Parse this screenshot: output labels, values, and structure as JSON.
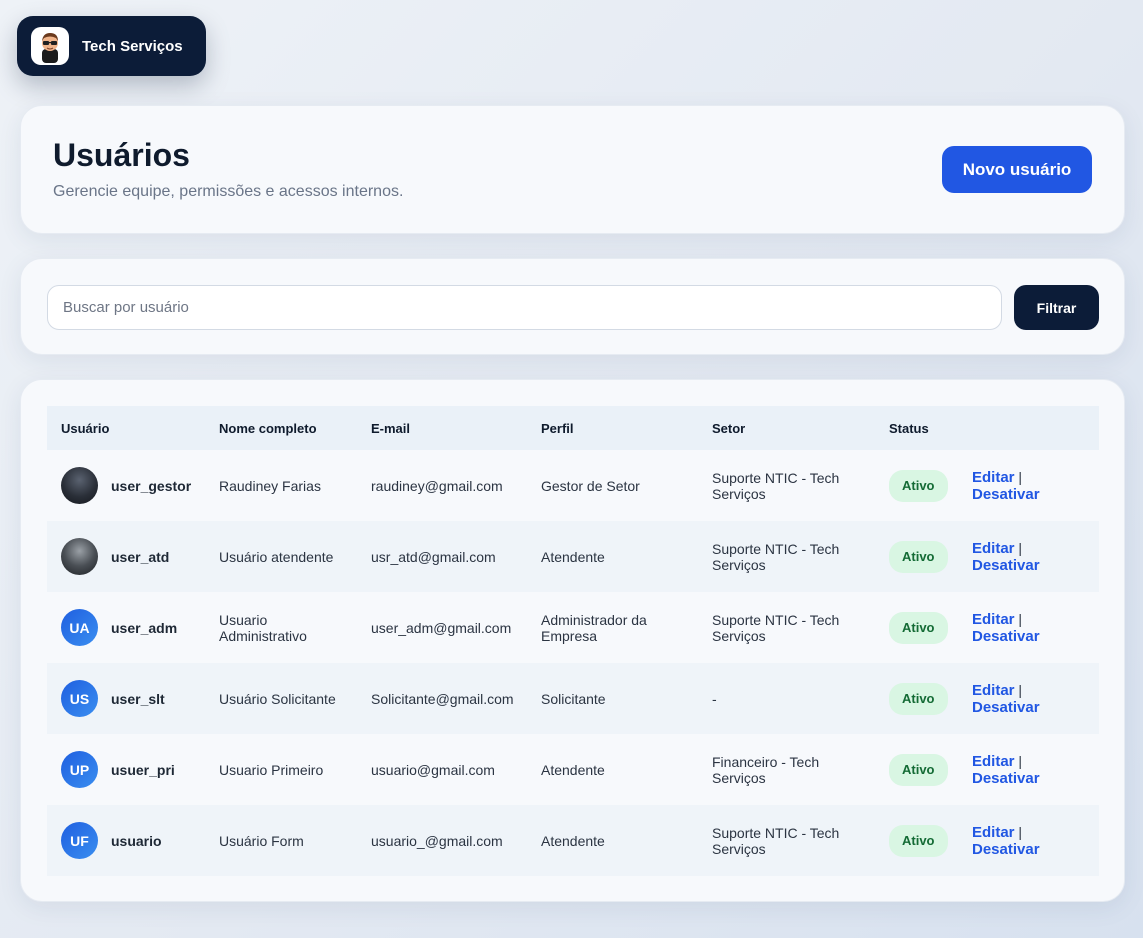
{
  "brand": {
    "name": "Tech Serviços"
  },
  "header": {
    "title": "Usuários",
    "subtitle": "Gerencie equipe, permissões e acessos internos.",
    "new_user_label": "Novo usuário"
  },
  "filter": {
    "placeholder": "Buscar por usuário",
    "button_label": "Filtrar"
  },
  "table": {
    "columns": [
      "Usuário",
      "Nome completo",
      "E-mail",
      "Perfil",
      "Setor",
      "Status"
    ],
    "rows": [
      {
        "avatar": "",
        "avatar_kind": "photo",
        "username": "user_gestor",
        "full_name": "Raudiney Farias",
        "email": "raudiney@gmail.com",
        "profile": "Gestor de Setor",
        "sector": "Suporte NTIC - Tech Serviços",
        "status": "Ativo",
        "edit": "Editar",
        "sep": "|",
        "deactivate": "Desativar"
      },
      {
        "avatar": "",
        "avatar_kind": "photo2",
        "username": "user_atd",
        "full_name": "Usuário atendente",
        "email": "usr_atd@gmail.com",
        "profile": "Atendente",
        "sector": "Suporte NTIC - Tech Serviços",
        "status": "Ativo",
        "edit": "Editar",
        "sep": "|",
        "deactivate": "Desativar"
      },
      {
        "avatar": "UA",
        "avatar_kind": "initials",
        "username": "user_adm",
        "full_name": "Usuario Administrativo",
        "email": "user_adm@gmail.com",
        "profile": "Administrador da Empresa",
        "sector": "Suporte NTIC - Tech Serviços",
        "status": "Ativo",
        "edit": "Editar",
        "sep": "|",
        "deactivate": "Desativar"
      },
      {
        "avatar": "US",
        "avatar_kind": "initials",
        "username": "user_slt",
        "full_name": "Usuário Solicitante",
        "email": "Solicitante@gmail.com",
        "profile": "Solicitante",
        "sector": "-",
        "status": "Ativo",
        "edit": "Editar",
        "sep": "|",
        "deactivate": "Desativar"
      },
      {
        "avatar": "UP",
        "avatar_kind": "initials",
        "username": "usuer_pri",
        "full_name": "Usuario Primeiro",
        "email": "usuario@gmail.com",
        "profile": "Atendente",
        "sector": "Financeiro - Tech Serviços",
        "status": "Ativo",
        "edit": "Editar",
        "sep": "|",
        "deactivate": "Desativar"
      },
      {
        "avatar": "UF",
        "avatar_kind": "initials",
        "username": "usuario",
        "full_name": "Usuário Form",
        "email": "usuario_@gmail.com",
        "profile": "Atendente",
        "sector": "Suporte NTIC - Tech Serviços",
        "status": "Ativo",
        "edit": "Editar",
        "sep": "|",
        "deactivate": "Desativar"
      }
    ]
  },
  "colors": {
    "brand_bg": "#0c1c38",
    "primary": "#2157e3",
    "status_active_bg": "#d9f6e3",
    "status_active_text": "#146b35"
  }
}
